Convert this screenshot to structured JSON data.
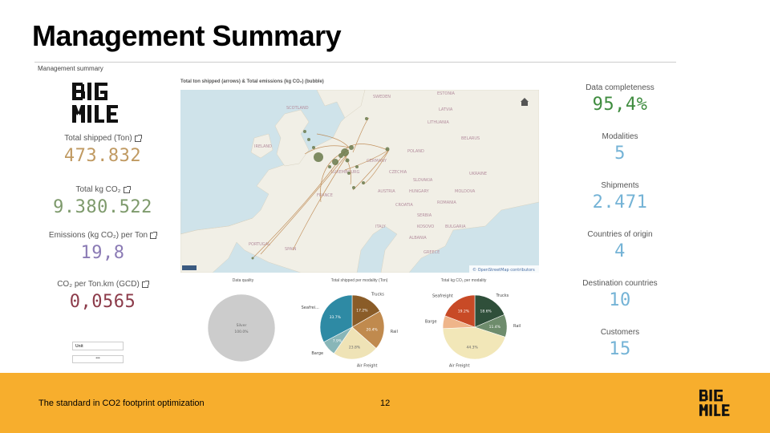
{
  "slide": {
    "title": "Management Summary",
    "footer_text": "The standard in CO2 footprint optimization",
    "page_number": "12"
  },
  "dashboard": {
    "label": "Management summary",
    "logo_text": "BIG MILE",
    "left_kpis": [
      {
        "label": "Total shipped (Ton)",
        "value": "473.832",
        "color": "#c09a62"
      },
      {
        "label": "Total kg CO₂",
        "value": "9.380.522",
        "color": "#7e9a6c"
      },
      {
        "label": "Emissions (kg CO₂) per Ton",
        "value": "19,8",
        "color": "#8b7bb5"
      },
      {
        "label": "CO₂ per Ton.km (GCD)",
        "value": "0,0565",
        "color": "#8c3b4a"
      }
    ],
    "right_kpis": [
      {
        "label": "Data completeness",
        "value": "95,4%",
        "color": "#3f8c3f"
      },
      {
        "label": "Modalities",
        "value": "5",
        "color": "#74b3d6"
      },
      {
        "label": "Shipments",
        "value": "2.471",
        "color": "#74b3d6"
      },
      {
        "label": "Countries of origin",
        "value": "4",
        "color": "#74b3d6"
      },
      {
        "label": "Destination countries",
        "value": "10",
        "color": "#74b3d6"
      },
      {
        "label": "Customers",
        "value": "15",
        "color": "#74b3d6"
      }
    ],
    "map": {
      "title": "Total ton shipped (arrows) & Total emissions (kg CO₂) (bubble)",
      "attribution": "© OpenStreetMap contributors",
      "home_icon": "home-icon",
      "country_labels": [
        "SWEDEN",
        "ESTONIA",
        "LATVIA",
        "LITHUANIA",
        "BELARUS",
        "POLAND",
        "GERMANY",
        "CZECHIA",
        "SLOVAKIA",
        "UKRAINE",
        "AUSTRIA",
        "HUNGARY",
        "MOLDOVA",
        "ROMANIA",
        "CROATIA",
        "SERBIA",
        "BULGARIA",
        "ITALY",
        "KOSOVO",
        "ALBANIA",
        "GREECE",
        "FRANCE",
        "SPAIN",
        "PORTUGAL",
        "SCOTLAND",
        "IRELAND",
        "LUXEMBOURG"
      ]
    },
    "controls": {
      "unit_label": "Unit",
      "unit_value": "•••"
    }
  },
  "chart_data": [
    {
      "type": "pie",
      "title": "Data quality",
      "series": [
        {
          "values": [
            100.0
          ]
        }
      ],
      "categories": [
        "Silver"
      ],
      "data_labels": [
        "100.0%"
      ],
      "colors": [
        "#cccccc"
      ]
    },
    {
      "type": "pie",
      "title": "Total shipped per modality (Ton)",
      "categories": [
        "Trucks",
        "Rail",
        "Air Freight",
        "Barge",
        "Seafreight"
      ],
      "display_categories": [
        "Trucks",
        "Rail",
        "Air Freight",
        "Barge",
        "Seafrei..."
      ],
      "values": [
        17.2,
        20.4,
        23.8,
        7.9,
        33.7
      ],
      "data_labels": [
        "17.2%",
        "20.4%",
        "23.8%",
        "7.9%",
        "33.7%"
      ],
      "colors": [
        "#8a5c28",
        "#c08a4e",
        "#efe3b6",
        "#88b6b8",
        "#2e8aa4"
      ]
    },
    {
      "type": "pie",
      "title": "Total kg CO₂ per modality",
      "categories": [
        "Trucks",
        "Rail",
        "Air Freight",
        "Barge",
        "Seafreight"
      ],
      "values": [
        18.6,
        11.4,
        44.3,
        6.5,
        19.2
      ],
      "data_labels": [
        "18.6%",
        "11.4%",
        "44.3%",
        "",
        "19.2%"
      ],
      "colors": [
        "#2f4f3a",
        "#6e8c6c",
        "#f2e7b8",
        "#efb58a",
        "#c84a26"
      ]
    }
  ]
}
